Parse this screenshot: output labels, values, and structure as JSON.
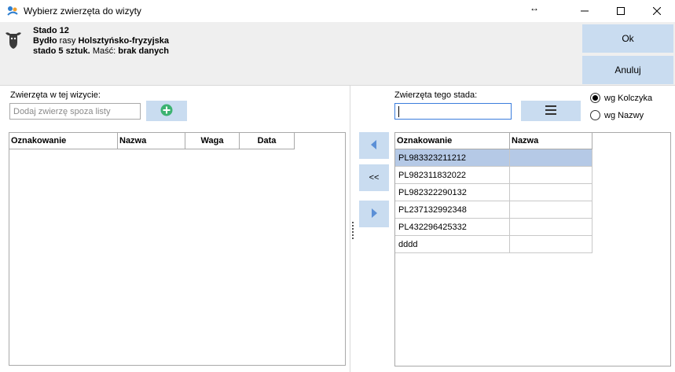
{
  "window": {
    "title": "Wybierz zwierzęta do wizyty",
    "resize_glyph": "↔"
  },
  "header": {
    "herd_name": "Stado 12",
    "breed_prefix": "Bydło",
    "breed_word": "rasy",
    "breed_name": "Holsztyńsko-fryzyjska",
    "count_text": "stado 5 sztuk.",
    "color_label": "Maść:",
    "color_value": "brak danych"
  },
  "buttons": {
    "ok": "Ok",
    "cancel": "Anuluj",
    "move_left": "◀",
    "move_all_left": "<<",
    "move_right": "▶"
  },
  "left_panel": {
    "label": "Zwierzęta w tej wizycie:",
    "add_placeholder": "Dodaj zwierzę spoza listy",
    "columns": [
      "Oznakowanie",
      "Nazwa",
      "Waga",
      "Data"
    ]
  },
  "right_panel": {
    "label": "Zwierzęta tego stada:",
    "search_value": "",
    "sort_options": [
      {
        "label": "wg Kolczyka",
        "selected": true
      },
      {
        "label": "wg Nazwy",
        "selected": false
      }
    ],
    "columns": [
      "Oznakowanie",
      "Nazwa"
    ],
    "rows": [
      {
        "tag": "PL983323211212",
        "name": "",
        "selected": true
      },
      {
        "tag": "PL982311832022",
        "name": "",
        "selected": false
      },
      {
        "tag": "PL982322290132",
        "name": "",
        "selected": false
      },
      {
        "tag": "PL237132992348",
        "name": "",
        "selected": false
      },
      {
        "tag": "PL432296425332",
        "name": "",
        "selected": false
      },
      {
        "tag": "dddd",
        "name": "",
        "selected": false
      }
    ]
  },
  "colors": {
    "accent": "#c9dcf0",
    "selected_row": "#b5c9e6",
    "add_icon": "#3cb371",
    "arrow_icon": "#5b8fd6"
  },
  "icons": {
    "app": "app-icon",
    "header": "cow-icon",
    "add": "plus-circle-icon",
    "list": "list-icon"
  }
}
